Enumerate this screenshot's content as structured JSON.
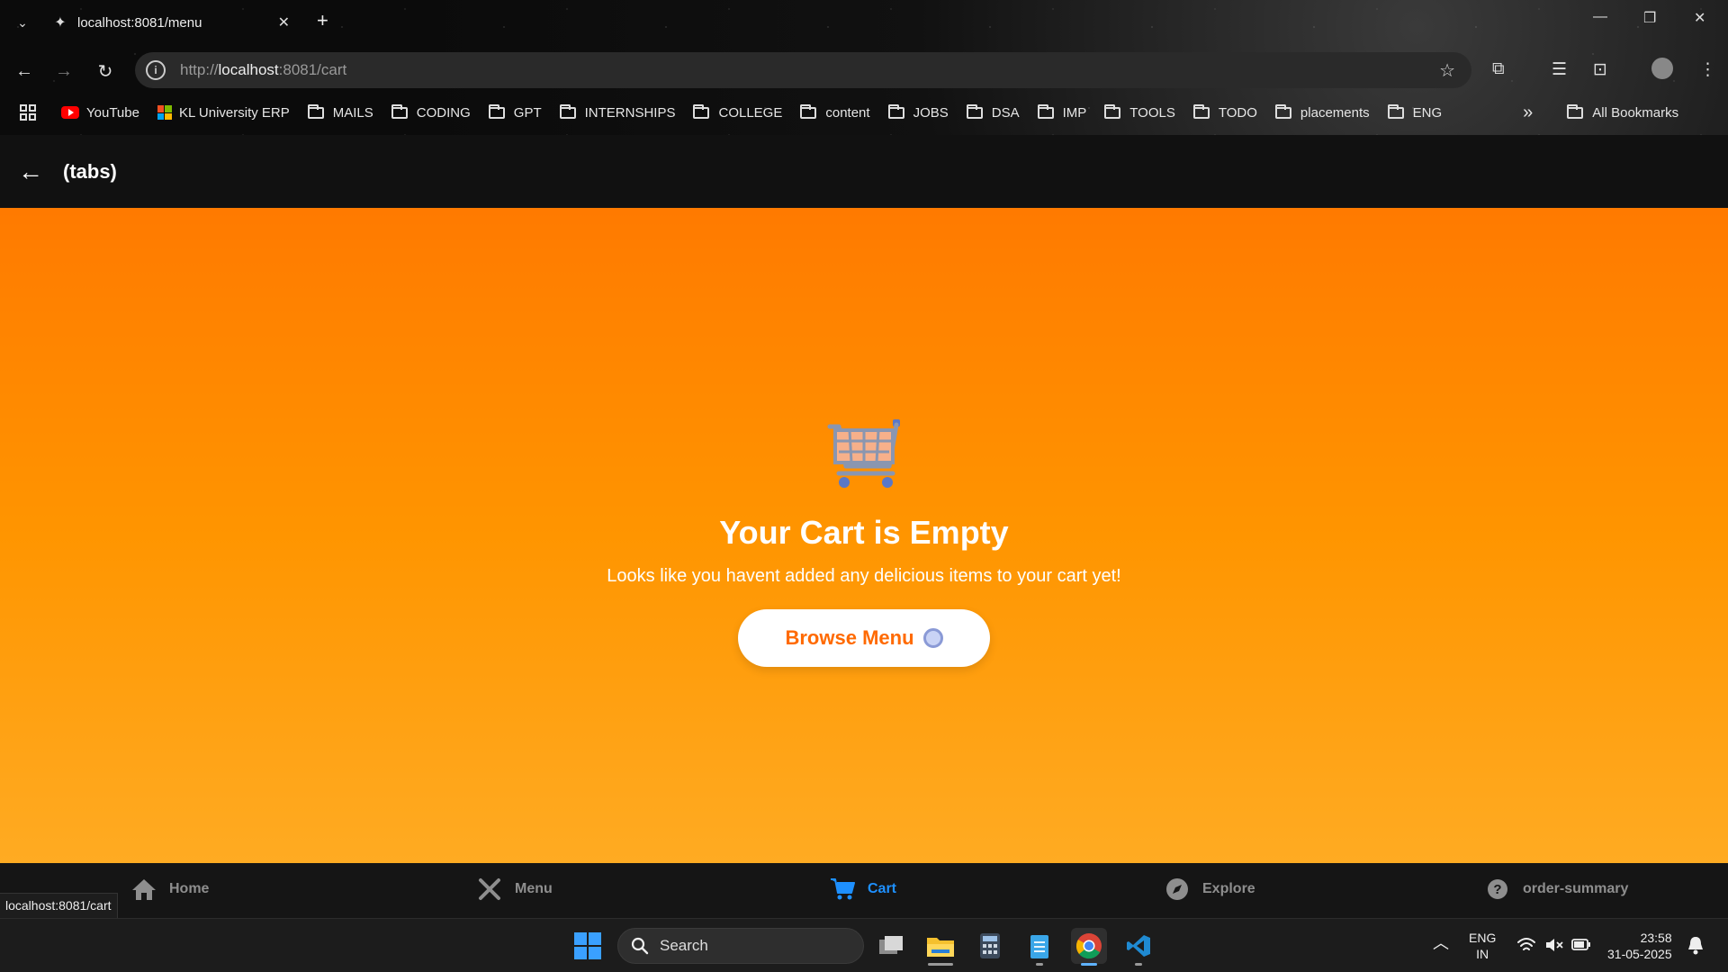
{
  "browser": {
    "tab_title": "localhost:8081/menu",
    "new_tab": "+",
    "url_prefix": "http://",
    "url_host": "localhost",
    "url_rest": ":8081/cart",
    "bookmarks": [
      "YouTube",
      "KL University ERP",
      "MAILS",
      "CODING",
      "GPT",
      "INTERNSHIPS",
      "COLLEGE",
      "content",
      "JOBS",
      "DSA",
      "IMP",
      "TOOLS",
      "TODO",
      "placements",
      "ENG"
    ],
    "more": "»",
    "all_bookmarks": "All Bookmarks"
  },
  "header": {
    "back": "←",
    "title": "(tabs)"
  },
  "empty_cart": {
    "title": "Your Cart is Empty",
    "subtitle": "Looks like you havent added any delicious items to your cart yet!",
    "button": "Browse Menu"
  },
  "tabs": [
    {
      "label": "Home",
      "icon": "home-icon",
      "active": false
    },
    {
      "label": "Menu",
      "icon": "utensils-icon",
      "active": false
    },
    {
      "label": "Cart",
      "icon": "cart-icon",
      "active": true
    },
    {
      "label": "Explore",
      "icon": "compass-icon",
      "active": false
    },
    {
      "label": "order-summary",
      "icon": "question-icon",
      "active": false
    }
  ],
  "status_url": "localhost:8081/cart",
  "taskbar": {
    "search": "Search",
    "lang1": "ENG",
    "lang2": "IN",
    "time": "23:58",
    "date": "31-05-2025"
  },
  "colors": {
    "accent_orange": "#ff7a00",
    "active_tab": "#1e90ff",
    "button_text": "#ff6a00"
  }
}
